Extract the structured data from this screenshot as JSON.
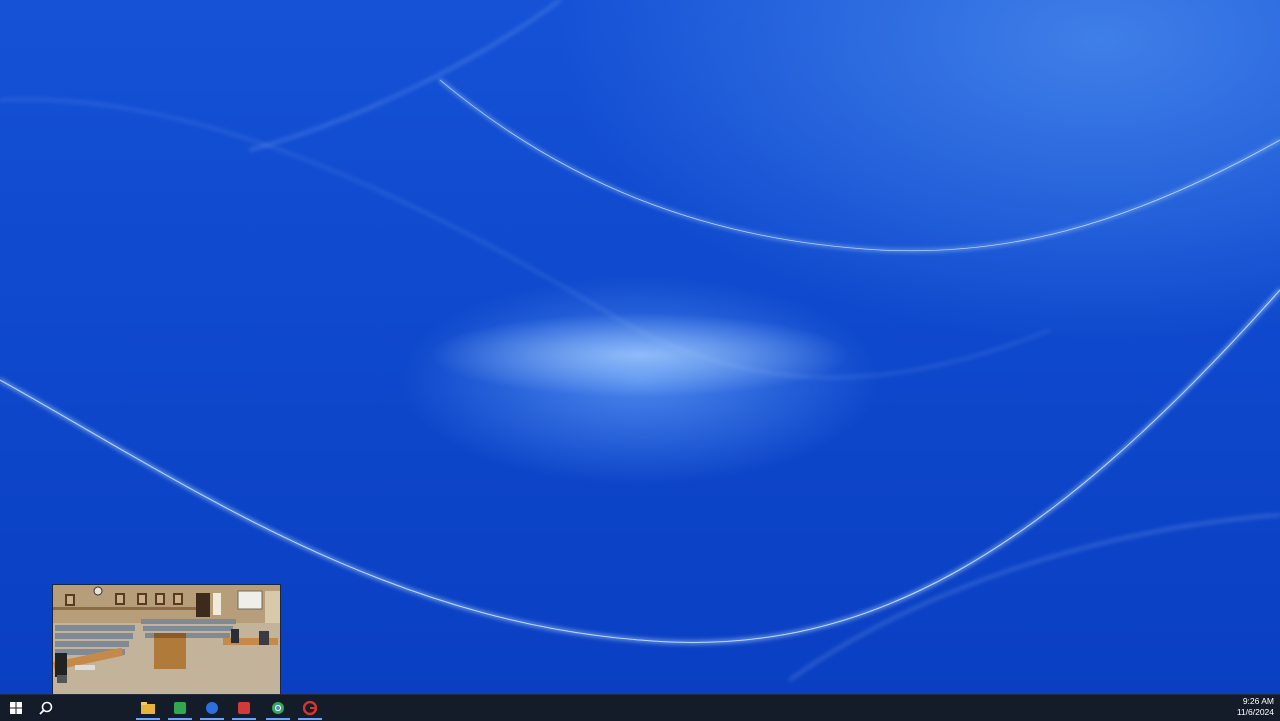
{
  "desktop": {
    "wallpaper": "blue-waves-wallpaper",
    "accent": "#1552d6"
  },
  "video_overlay": {
    "scene": "meeting-room-camera-feed"
  },
  "taskbar": {
    "start_icon": "windows-logo-icon",
    "search_icon": "search-icon",
    "pinned_apps": [
      {
        "icon": "file-explorer-icon",
        "color": "#e8b33a"
      },
      {
        "icon": "app-green-icon",
        "color": "#2fa84f"
      },
      {
        "icon": "app-blue-icon",
        "color": "#2b6fe0"
      },
      {
        "icon": "app-red-icon",
        "color": "#d23a3a"
      },
      {
        "icon": "chrome-icon",
        "color": "#34a853"
      },
      {
        "icon": "app-red-g-icon",
        "color": "#d9342b"
      }
    ],
    "clock": {
      "time": "9:26 AM",
      "date": "11/6/2024"
    }
  }
}
